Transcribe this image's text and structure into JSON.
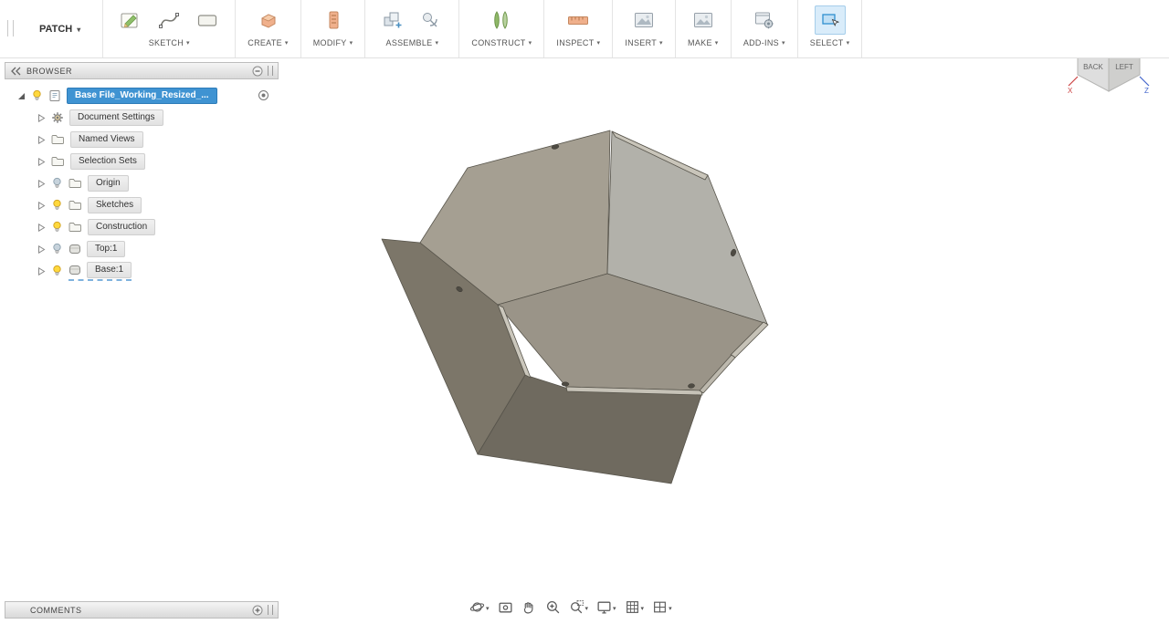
{
  "workspace": {
    "label": "PATCH"
  },
  "toolbar": {
    "groups": [
      {
        "label": "SKETCH"
      },
      {
        "label": "CREATE"
      },
      {
        "label": "MODIFY"
      },
      {
        "label": "ASSEMBLE"
      },
      {
        "label": "CONSTRUCT"
      },
      {
        "label": "INSPECT"
      },
      {
        "label": "INSERT"
      },
      {
        "label": "MAKE"
      },
      {
        "label": "ADD-INS"
      },
      {
        "label": "SELECT"
      }
    ]
  },
  "browser": {
    "title": "BROWSER",
    "root": {
      "label": "Base File_Working_Resized_...",
      "selected": true,
      "bulb": "on"
    },
    "items": [
      {
        "label": "Document Settings",
        "icon": "gear-icon"
      },
      {
        "label": "Named Views",
        "icon": "folder-icon"
      },
      {
        "label": "Selection Sets",
        "icon": "folder-icon"
      },
      {
        "label": "Origin",
        "icon": "folder-icon",
        "bulb": "off"
      },
      {
        "label": "Sketches",
        "icon": "folder-icon",
        "bulb": "on"
      },
      {
        "label": "Construction",
        "icon": "folder-icon",
        "bulb": "on"
      },
      {
        "label": "Top:1",
        "icon": "body-icon",
        "bulb": "off"
      },
      {
        "label": "Base:1",
        "icon": "body-icon",
        "bulb": "on",
        "editing": true
      }
    ]
  },
  "viewcube": {
    "face_back": "BACK",
    "face_left": "LEFT",
    "axis_x": "X",
    "axis_z": "Z"
  },
  "comments": {
    "title": "COMMENTS"
  },
  "nav": {
    "tools": [
      "orbit",
      "look-at",
      "pan",
      "zoom",
      "zoom-window",
      "display-settings",
      "grid-display",
      "viewports"
    ]
  },
  "colors": {
    "selection_blue": "#3f93d2",
    "icon_peach": "#f0b08c",
    "bulb_on": "#ffd83d",
    "bulb_off": "#c7d3dc",
    "model_light_face": "#b2b1aa",
    "model_medium_face": "#a59f92",
    "model_dark_face": "#6f6a5f"
  }
}
